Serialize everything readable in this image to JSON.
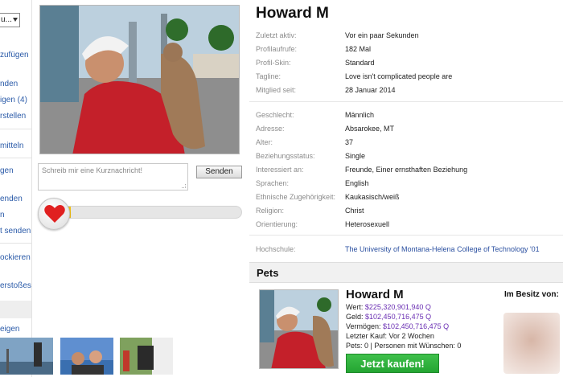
{
  "sidebar": {
    "select_value": "u...",
    "items": [
      {
        "label": "zufügen"
      },
      {
        "label": "nden"
      },
      {
        "label": "igen (4)"
      },
      {
        "label": "rstellen"
      },
      {
        "label": "mitteln"
      },
      {
        "label": "gen"
      },
      {
        "label": "enden"
      },
      {
        "label": "n"
      },
      {
        "label": "t senden"
      },
      {
        "label": "ockieren"
      },
      {
        "label": "erstoßes"
      },
      {
        "label": "eigen"
      }
    ]
  },
  "shoutbox": {
    "placeholder": "Schreib mir eine Kurznachricht!",
    "send_label": "Senden"
  },
  "heart_meter": {
    "fill_fraction": 0.13,
    "accent": "#f2c014",
    "heart_color": "#e02020"
  },
  "profile": {
    "name": "Howard M",
    "details_top": [
      {
        "label": "Zuletzt aktiv:",
        "value": "Vor ein paar Sekunden"
      },
      {
        "label": "Profilaufrufe:",
        "value": "182 Mal"
      },
      {
        "label": "Profil-Skin:",
        "value": "Standard"
      },
      {
        "label": "Tagline:",
        "value": "Love isn't complicated people are"
      },
      {
        "label": "Mitglied seit:",
        "value": "28 Januar 2014"
      }
    ],
    "details_mid": [
      {
        "label": "Geschlecht:",
        "value": "Männlich"
      },
      {
        "label": "Adresse:",
        "value": "Absarokee, MT"
      },
      {
        "label": "Alter:",
        "value": "37"
      },
      {
        "label": "Beziehungsstatus:",
        "value": "Single"
      },
      {
        "label": "Interessiert an:",
        "value": "Freunde, Einer ernsthaften Beziehung"
      },
      {
        "label": "Sprachen:",
        "value": "English"
      },
      {
        "label": "Ethnische Zugehörigkeit:",
        "value": "Kaukasisch/weiß"
      },
      {
        "label": "Religion:",
        "value": "Christ"
      },
      {
        "label": "Orientierung:",
        "value": "Heterosexuell"
      }
    ],
    "school": {
      "label": "Hochschule:",
      "value": "The University of Montana-Helena College of Technology '01"
    }
  },
  "pets": {
    "heading": "Pets",
    "name": "Howard M",
    "wert_label": "Wert:",
    "wert": "$225,320,901,940 Q",
    "geld_label": "Geld:",
    "geld": "$102,450,716,475 Q",
    "vermoegen_label": "Vermögen:",
    "vermoegen": "$102,450,716,475 Q",
    "letzter_kauf": "Letzter Kauf: Vor 2 Wochen",
    "pets_line": "Pets: 0 | Personen mit Wünschen: 0",
    "buy_label": "Jetzt kaufen!",
    "owner_label": "Im Besitz von:"
  }
}
